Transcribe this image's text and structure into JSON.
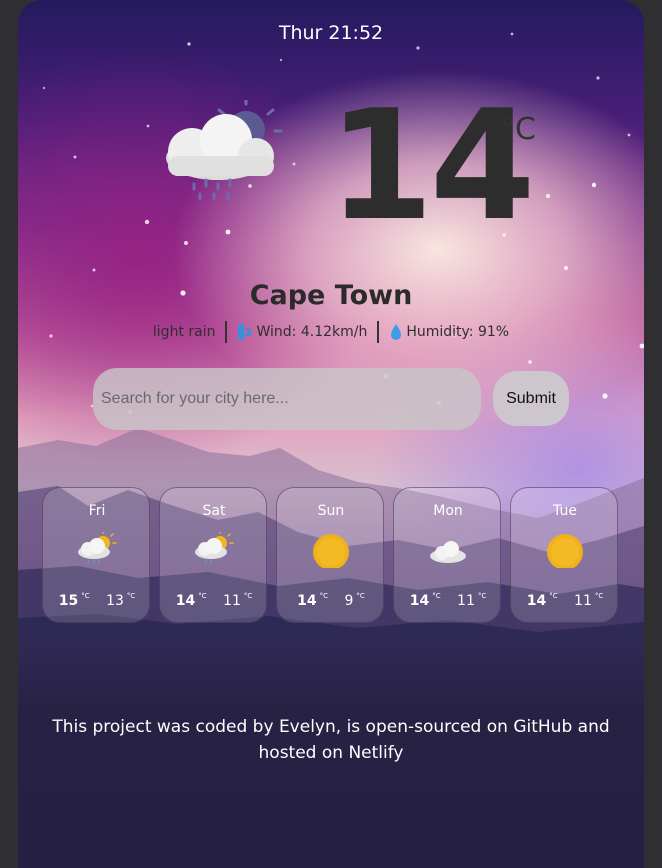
{
  "datetime": "Thur 21:52",
  "current": {
    "temperature": "14",
    "unit": "°C",
    "city": "Cape Town",
    "description": "light rain",
    "wind_label": "Wind: 4.12km/h",
    "humidity_label": "Humidity: 91%",
    "icon": "cloud-rain-moon-icon"
  },
  "search": {
    "placeholder": "Search for your city here...",
    "submit_label": "Submit"
  },
  "forecast": [
    {
      "day": "Fri",
      "max": "15",
      "min": "13",
      "unit": "°C",
      "icon": "sun-cloud-rain-icon"
    },
    {
      "day": "Sat",
      "max": "14",
      "min": "11",
      "unit": "°C",
      "icon": "sun-cloud-rain-icon"
    },
    {
      "day": "Sun",
      "max": "14",
      "min": "9",
      "unit": "°C",
      "icon": "sun-icon"
    },
    {
      "day": "Mon",
      "max": "14",
      "min": "11",
      "unit": "°C",
      "icon": "cloud-icon"
    },
    {
      "day": "Tue",
      "max": "14",
      "min": "11",
      "unit": "°C",
      "icon": "sun-icon"
    }
  ],
  "footer": {
    "text": "This project was coded by Evelyn,  is open-sourced on GitHub and hosted on Netlify"
  },
  "colors": {
    "temperature": "#2d2d2d",
    "sun": "#f2b51c",
    "card_dark": "#272244"
  }
}
